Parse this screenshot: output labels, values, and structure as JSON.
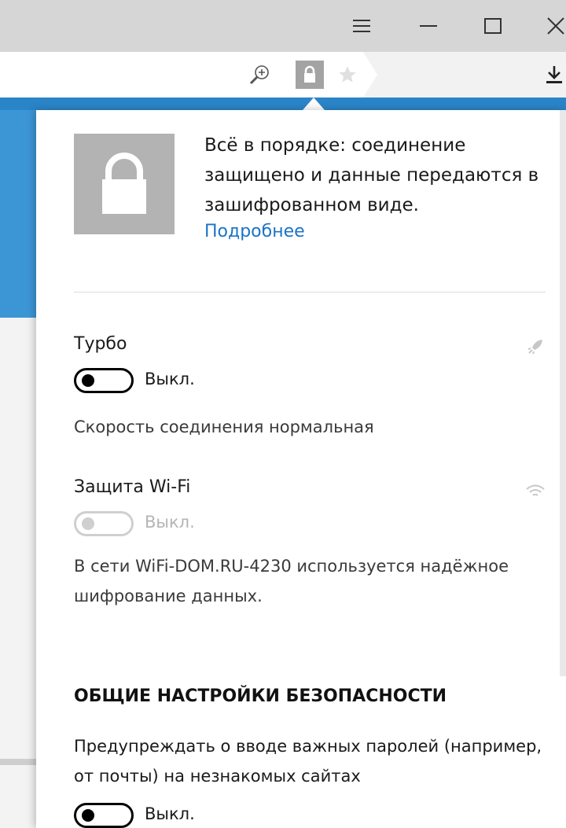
{
  "window": {
    "controls": [
      "menu",
      "minimize",
      "maximize",
      "close"
    ]
  },
  "toolbar": {
    "icons": [
      "zoom-icon",
      "lock-icon",
      "star-icon",
      "download-icon"
    ]
  },
  "security": {
    "status_text": "Всё в порядке: соединение защищено и данные передаются в зашифрованном виде.",
    "more_link": "Подробнее"
  },
  "turbo": {
    "label": "Турбо",
    "state": "Выкл.",
    "description": "Скорость соединения нормальная",
    "icon": "rocket-icon"
  },
  "wifi": {
    "label": "Защита Wi-Fi",
    "state": "Выкл.",
    "description": "В сети WiFi-DOM.RU-4230 используется надёжное шифрование данных.",
    "icon": "wifi-icon"
  },
  "general": {
    "heading": "ОБЩИЕ НАСТРОЙКИ БЕЗОПАСНОСТИ",
    "password_warning": {
      "label": "Предупреждать о вводе важных паролей (например, от почты) на незнакомых сайтах",
      "state": "Выкл."
    }
  },
  "colors": {
    "accent": "#3c96d6",
    "link": "#1a73c8",
    "lock_box": "#b3b3b3"
  }
}
